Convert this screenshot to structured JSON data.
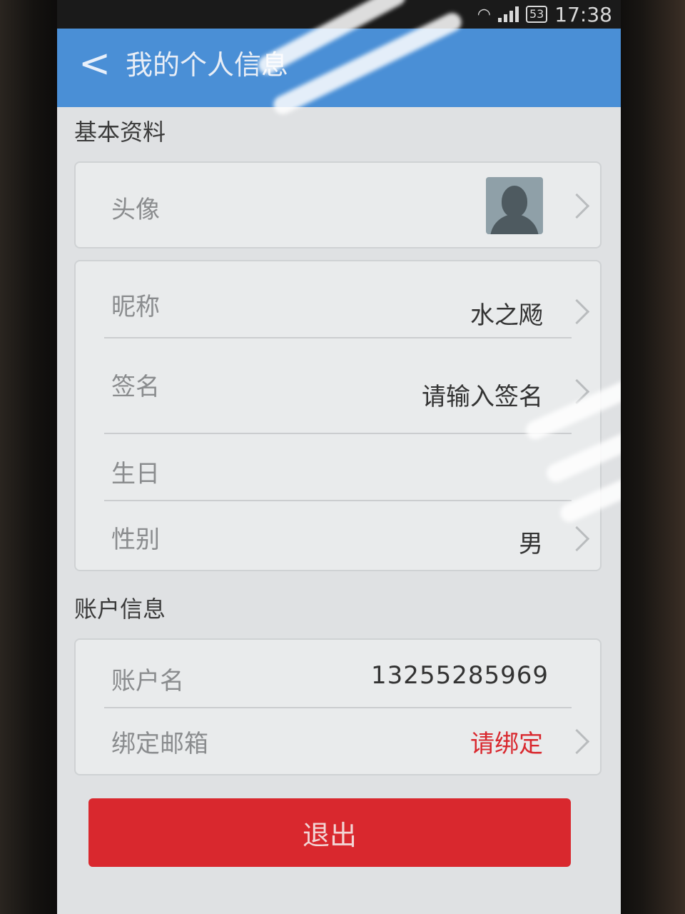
{
  "status_bar": {
    "battery": "53",
    "time": "17:38"
  },
  "header": {
    "back_label": "<",
    "title": "我的个人信息"
  },
  "basic_section": {
    "title": "基本资料",
    "avatar_label": "头像",
    "nickname_label": "昵称",
    "nickname_value": "水之飏",
    "signature_label": "签名",
    "signature_value": "请输入签名",
    "birthday_label": "生日",
    "birthday_value": "",
    "gender_label": "性别",
    "gender_value": "男"
  },
  "account_section": {
    "title": "账户信息",
    "account_label": "账户名",
    "account_value": "13255285969",
    "email_label": "绑定邮箱",
    "email_value": "请绑定"
  },
  "logout_label": "退出",
  "colors": {
    "appbar": "#4a8fd6",
    "logout": "#d9282e",
    "warning_text": "#d9282e"
  }
}
